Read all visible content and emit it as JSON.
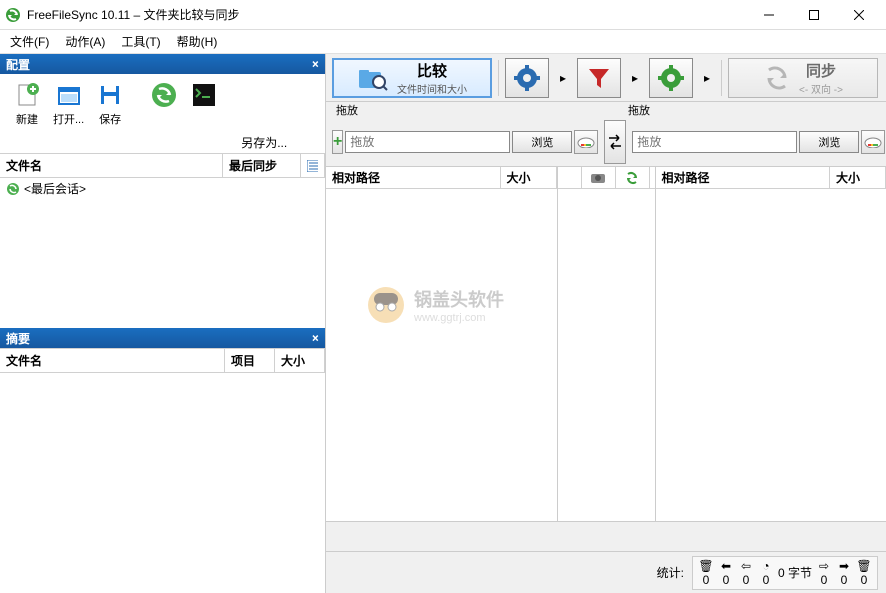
{
  "title": "FreeFileSync 10.11 – 文件夹比较与同步",
  "menu": {
    "file": "文件(F)",
    "actions": "动作(A)",
    "tools": "工具(T)",
    "help": "帮助(H)"
  },
  "panels": {
    "config": {
      "title": "配置",
      "col_name": "文件名",
      "col_last": "最后同步"
    },
    "summary": {
      "title": "摘要",
      "col_name": "文件名",
      "col_items": "项目",
      "col_size": "大小"
    }
  },
  "toolbar": {
    "new": "新建",
    "open": "打开...",
    "save": "保存",
    "saveas": "另存为..."
  },
  "session": "<最后会话>",
  "actions": {
    "compare": {
      "title": "比较",
      "subtitle": "文件时间和大小"
    },
    "sync": {
      "title": "同步",
      "subtitle": "<- 双向 ->"
    }
  },
  "paths": {
    "drop": "拖放",
    "browse": "浏览"
  },
  "grid": {
    "relpath": "相对路径",
    "size": "大小"
  },
  "status": {
    "label": "统计:",
    "vals": [
      "0",
      "0",
      "0",
      "0",
      "0 字节",
      "0",
      "0",
      "0"
    ]
  },
  "watermark": {
    "line1": "锅盖头软件",
    "line2": "www.ggtrj.com"
  }
}
